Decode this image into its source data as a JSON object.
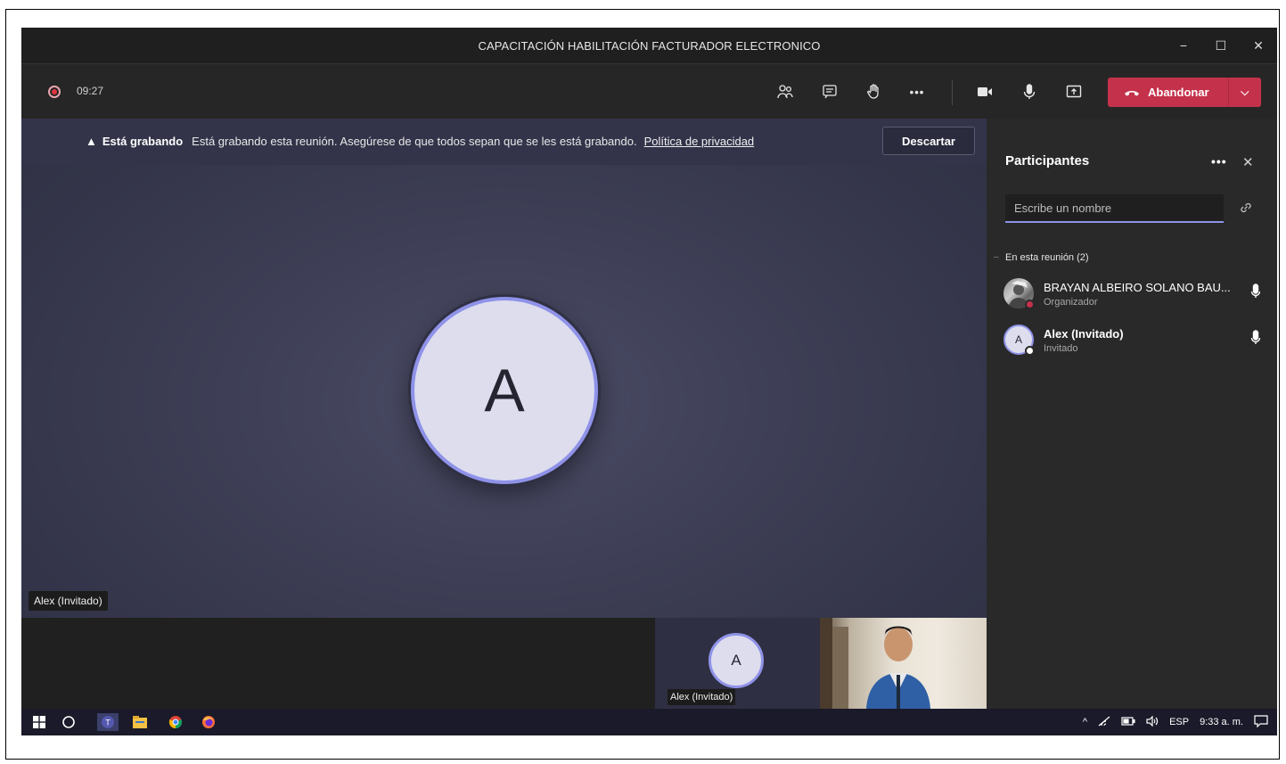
{
  "window": {
    "title": "CAPACITACIÓN HABILITACIÓN FACTURADOR ELECTRONICO",
    "minimize": "−",
    "maximize": "☐",
    "close": "✕"
  },
  "toolbar": {
    "recording_time": "09:27",
    "leave_label": "Abandonar",
    "leave_caret": "⌵",
    "more_label": "•••"
  },
  "banner": {
    "title": "Está grabando",
    "message": "Está grabando esta reunión. Asegúrese de que todos sepan que se les está grabando.",
    "link": "Política de privacidad",
    "dismiss_label": "Descartar"
  },
  "stage": {
    "avatar_initial": "A",
    "name_label": "Alex (Invitado)"
  },
  "strip": {
    "tile_initial": "A",
    "tile_label": "Alex (Invitado)"
  },
  "panel": {
    "title": "Participantes",
    "more": "•••",
    "close": "✕",
    "search_placeholder": "Escribe un nombre",
    "section_label": "En esta reunión (2)",
    "participants": [
      {
        "name": "BRAYAN ALBEIRO SOLANO BAU...",
        "role": "Organizador",
        "status_color": "#c4314b"
      },
      {
        "name": "Alex (Invitado)",
        "role": "Invitado",
        "initial": "A",
        "status_color": "#ffffff"
      }
    ]
  },
  "taskbar": {
    "language": "ESP",
    "time": "9:33 a. m."
  },
  "colors": {
    "accent": "#8f92e8",
    "leave": "#c4314b",
    "stage": "#3e3f56"
  }
}
